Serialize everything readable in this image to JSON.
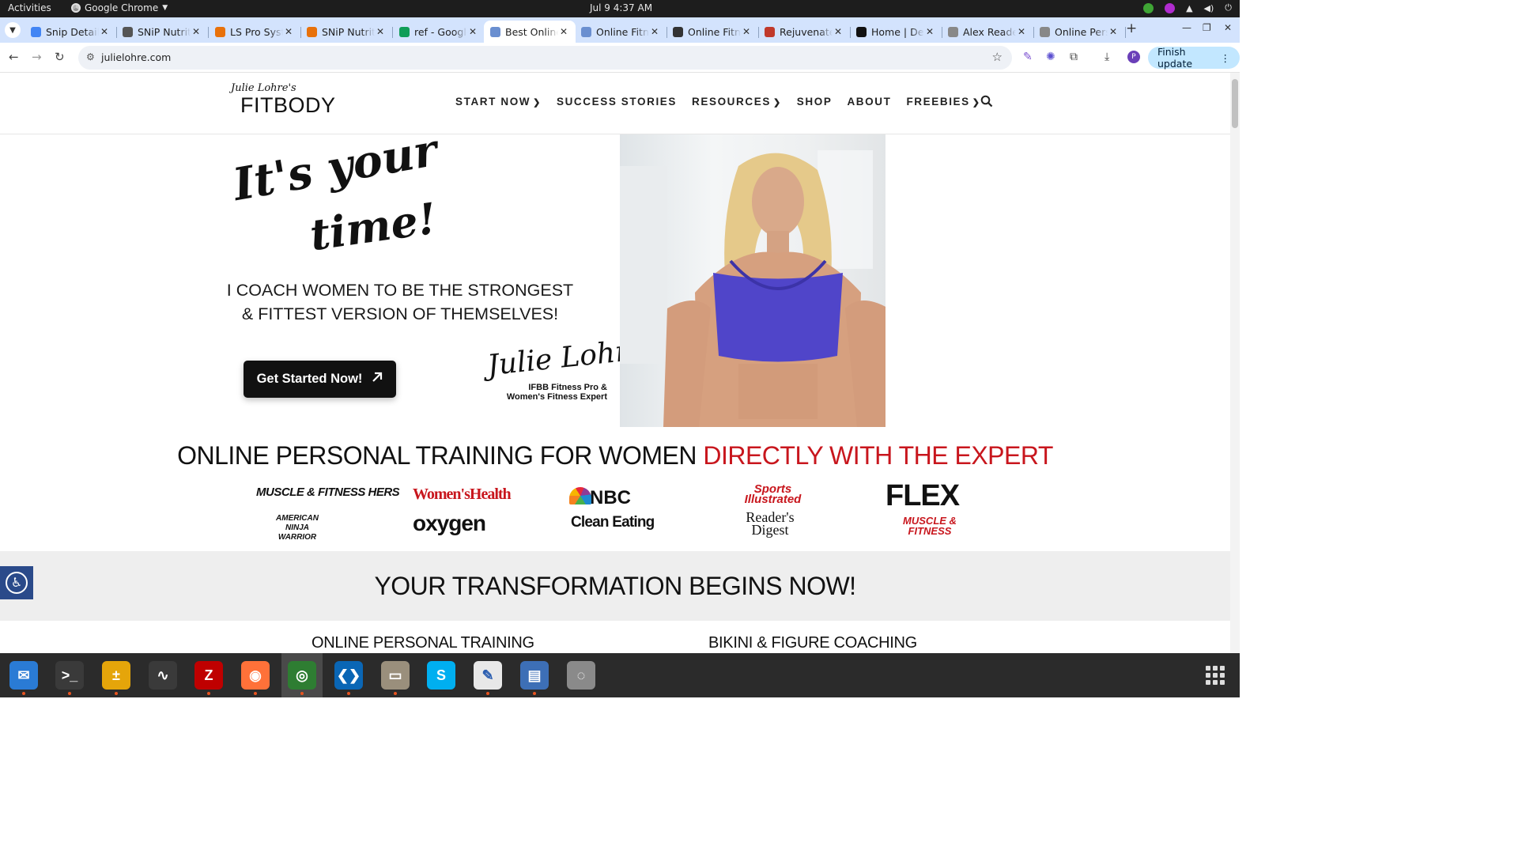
{
  "system_bar": {
    "activities": "Activities",
    "app_name": "Google Chrome",
    "clock": "Jul 9   4:37 AM"
  },
  "tabs": [
    {
      "label": "Snip Details",
      "favicon": "docs-icon",
      "color": "#4285f4"
    },
    {
      "label": "SNiP Nutrition",
      "favicon": "snip-icon",
      "color": "#555555"
    },
    {
      "label": "LS Pro System",
      "favicon": "ls-icon",
      "color": "#e8710a"
    },
    {
      "label": "SNiP Nutrition",
      "favicon": "snip-icon",
      "color": "#e8710a"
    },
    {
      "label": "ref - Google Sheets",
      "favicon": "sheets-icon",
      "color": "#0f9d58"
    },
    {
      "label": "Best Online Fitness",
      "favicon": "fitbody-icon",
      "color": "#6a8fd0",
      "active": true
    },
    {
      "label": "Online Fitness",
      "favicon": "fitbody-icon",
      "color": "#6a8fd0"
    },
    {
      "label": "Online Fitness",
      "favicon": "g-icon",
      "color": "#333333"
    },
    {
      "label": "Rejuvenate",
      "favicon": "rejuv-icon",
      "color": "#c0392b"
    },
    {
      "label": "Home | Dee",
      "favicon": "home-icon",
      "color": "#111111"
    },
    {
      "label": "Alex Reade",
      "favicon": "page-icon",
      "color": "#888888"
    },
    {
      "label": "Online Personal",
      "favicon": "page-icon",
      "color": "#888888"
    }
  ],
  "toolbar": {
    "url": "julielohre.com",
    "finish_update": "Finish update"
  },
  "site": {
    "logo_script": "Julie Lohre's",
    "logo_brand": "FITBODY",
    "nav": [
      "START NOW",
      "SUCCESS STORIES",
      "RESOURCES",
      "SHOP",
      "ABOUT",
      "FREEBIES"
    ],
    "hero_line1": "It's your",
    "hero_line2": "time!",
    "tagline_1": "I COACH WOMEN TO BE THE STRONGEST",
    "tagline_2": "& FITTEST VERSION OF THEMSELVES!",
    "cta": "Get Started Now!",
    "signature": "Julie Lohre",
    "signature_sub1": "IFBB Fitness Pro &",
    "signature_sub2": "Women's Fitness Expert",
    "headline_black": "ONLINE PERSONAL TRAINING FOR WOMEN ",
    "headline_red": "DIRECTLY WITH THE EXPERT",
    "press_top": [
      "MUSCLE & FITNESS HERS",
      "Women'sHealth",
      "NBC",
      "Sports Illustrated",
      "FLEX"
    ],
    "press_bottom": [
      "AMERICAN NINJA WARRIOR",
      "oxygen",
      "Clean Eating",
      "Reader's Digest",
      "MUSCLE & FITNESS"
    ],
    "band_title": "YOUR TRANSFORMATION BEGINS NOW!",
    "program_left": "ONLINE PERSONAL TRAINING",
    "program_right": "BIKINI & FIGURE COACHING",
    "accent_red": "#c8161d"
  },
  "dock": [
    {
      "name": "thunderbird-icon",
      "glyph": "✉",
      "color": "#2a7bd5",
      "running": true
    },
    {
      "name": "terminal-icon",
      "glyph": ">_",
      "color": "#3a3a3a",
      "running": true
    },
    {
      "name": "calculator-icon",
      "glyph": "±",
      "color": "#e5a50a",
      "running": true
    },
    {
      "name": "system-monitor-icon",
      "glyph": "∿",
      "color": "#3a3a3a",
      "running": false
    },
    {
      "name": "filezilla-icon",
      "glyph": "Z",
      "color": "#bf0000",
      "running": true
    },
    {
      "name": "firefox-icon",
      "glyph": "◉",
      "color": "#ff7139",
      "running": true
    },
    {
      "name": "chrome-icon",
      "glyph": "◎",
      "color": "#2e7d32",
      "running": true
    },
    {
      "name": "vscode-icon",
      "glyph": "❮❯",
      "color": "#0a66b5",
      "running": true
    },
    {
      "name": "files-icon",
      "glyph": "▭",
      "color": "#9a8f7c",
      "running": true
    },
    {
      "name": "skype-icon",
      "glyph": "S",
      "color": "#00aff0",
      "running": false
    },
    {
      "name": "text-editor-icon",
      "glyph": "✎",
      "color": "#e8e8e8",
      "running": true
    },
    {
      "name": "document-viewer-icon",
      "glyph": "▤",
      "color": "#3d6fb6",
      "running": true
    },
    {
      "name": "disc-icon",
      "glyph": "◌",
      "color": "#8a8a8a",
      "running": false
    }
  ]
}
